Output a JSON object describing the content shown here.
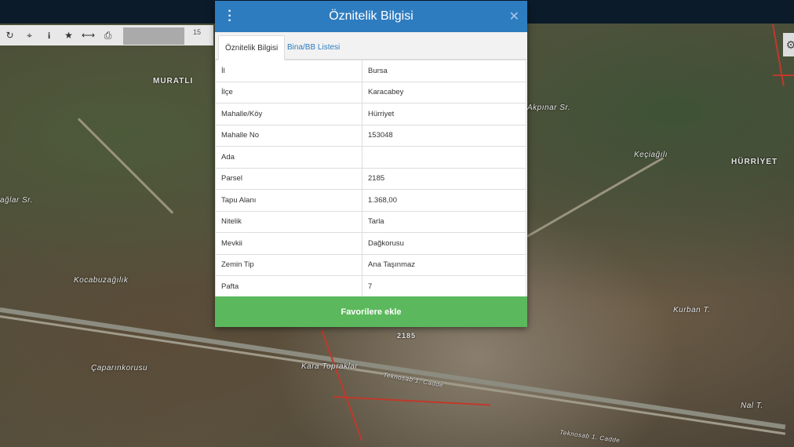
{
  "toolbar": {
    "tools": [
      "refresh-icon",
      "locate-icon",
      "info-icon",
      "star-icon",
      "measure-icon",
      "print-icon"
    ],
    "scale_value": "15"
  },
  "map": {
    "labels": {
      "muratli": "MURATLI",
      "akpinar": "Akpınar Sr.",
      "kecagili": "Keçiağılı",
      "hurriyet": "HÜRRİYET",
      "daglar": "ağlar Sr.",
      "kocabuzagilik": "Kocabuzağılık",
      "kurban": "Kurban T.",
      "parcel_num": "2185",
      "kara_topraklar": "Kara Topraklar",
      "teknosab1": "Teknosab 1. Cadde",
      "caparinkorusu": "Çaparınkorusu",
      "nal": "Nal T.",
      "teknosab2": "Teknosab 1. Cadde"
    }
  },
  "dialog": {
    "title": "Öznitelik Bilgisi",
    "tabs": [
      {
        "label": "Öznitelik Bilgisi",
        "active": true
      },
      {
        "label": "Bina/BB Listesi",
        "active": false
      }
    ],
    "rows": [
      {
        "key": "İl",
        "value": "Bursa"
      },
      {
        "key": "İlçe",
        "value": "Karacabey"
      },
      {
        "key": "Mahalle/Köy",
        "value": "Hürriyet"
      },
      {
        "key": "Mahalle No",
        "value": "153048"
      },
      {
        "key": "Ada",
        "value": ""
      },
      {
        "key": "Parsel",
        "value": "2185"
      },
      {
        "key": "Tapu Alanı",
        "value": "1.368,00"
      },
      {
        "key": "Nitelik",
        "value": "Tarla"
      },
      {
        "key": "Mevkii",
        "value": "Dağkorusu"
      },
      {
        "key": "Zemin Tip",
        "value": "Ana Taşınmaz"
      },
      {
        "key": "Pafta",
        "value": "7"
      }
    ],
    "favorite_button": "Favorilere ekle"
  },
  "colors": {
    "header_blue": "#2e7cc0",
    "button_green": "#5cb85c",
    "parcel_line_red": "#c0392b"
  }
}
